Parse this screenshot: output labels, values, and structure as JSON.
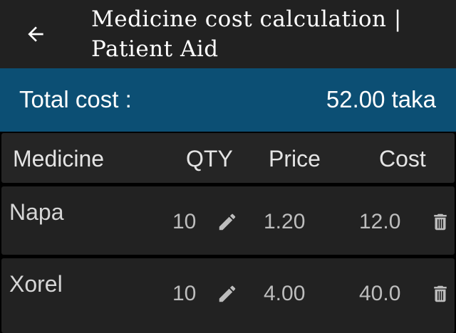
{
  "app_bar": {
    "back_icon": "arrow-left-icon",
    "title": "Medicine cost calculation | Patient Aid"
  },
  "total": {
    "label": "Total cost :",
    "value": "52.00 taka"
  },
  "table": {
    "headers": {
      "medicine": "Medicine",
      "qty": "QTY",
      "price": "Price",
      "cost": "Cost"
    },
    "rows": [
      {
        "name": "Napa",
        "qty": "10",
        "price": "1.20",
        "cost": "12.0"
      },
      {
        "name": "Xorel",
        "qty": "10",
        "price": "4.00",
        "cost": "40.0"
      }
    ],
    "edit_icon": "pencil-icon",
    "delete_icon": "trash-icon"
  },
  "colors": {
    "app_bar": "#212121",
    "total_bar": "#0c4f74",
    "card": "#222222",
    "background": "#000000"
  }
}
